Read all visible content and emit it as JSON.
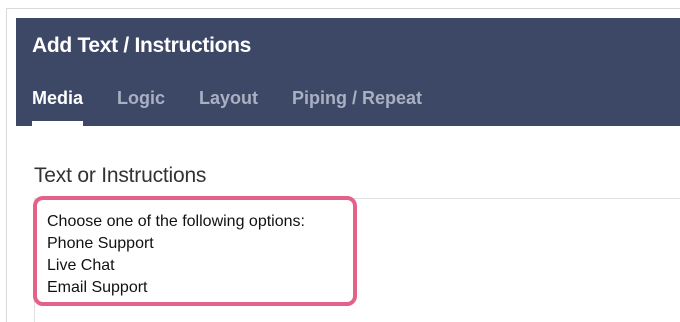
{
  "dialog": {
    "title": "Add Text / Instructions",
    "tabs": [
      {
        "label": "Media",
        "active": true
      },
      {
        "label": "Logic",
        "active": false
      },
      {
        "label": "Layout",
        "active": false
      },
      {
        "label": "Piping / Repeat",
        "active": false
      }
    ]
  },
  "form": {
    "field_label": "Text or Instructions",
    "content_lines": [
      "Choose one of the following options:",
      "Phone Support",
      "Live Chat",
      "Email Support"
    ]
  },
  "colors": {
    "header_bg": "#3d4866",
    "tab_inactive": "#a9b0c2",
    "highlight_border": "#e4628a"
  }
}
